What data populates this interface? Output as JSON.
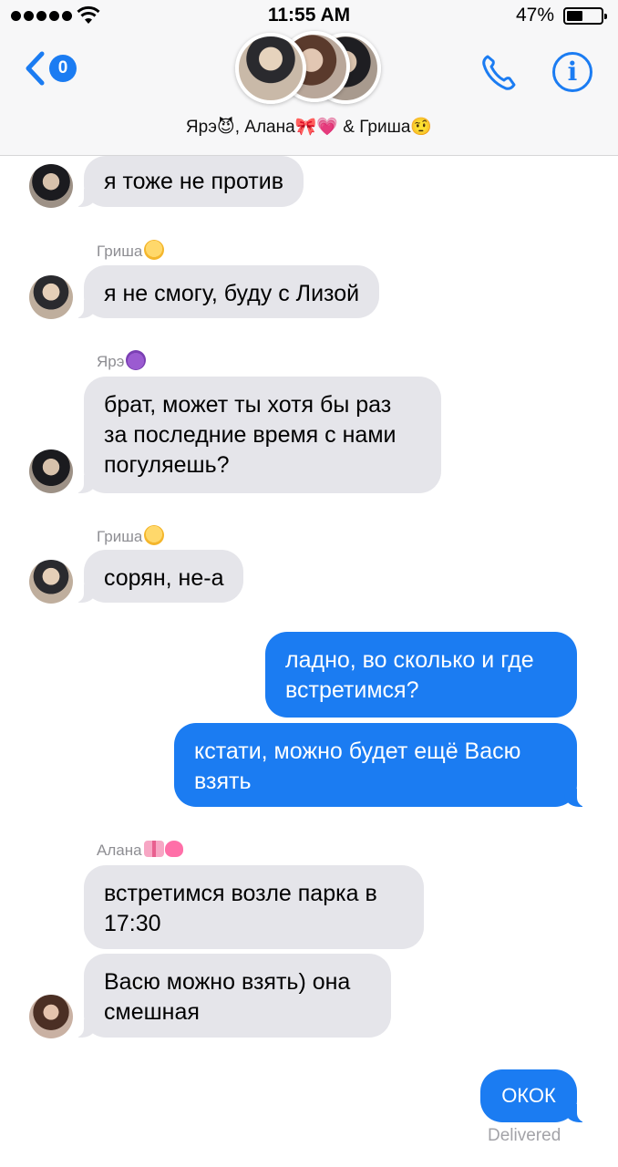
{
  "status_bar": {
    "time": "11:55 AM",
    "battery": "47%"
  },
  "header": {
    "back_badge": "0",
    "conversation_title": "Ярэ😈, Алана🎀💗 & Гриша🤨",
    "icons": {
      "back": "chevron-left-icon",
      "call": "phone-icon",
      "info": "info-icon"
    }
  },
  "senders": {
    "grisha": "Гриша",
    "yare": "Ярэ",
    "alana": "Алана"
  },
  "messages": [
    {
      "from": "yare",
      "text": "я тоже не против"
    },
    {
      "from": "grisha",
      "text": "я не смогу, буду с Лизой"
    },
    {
      "from": "yare",
      "text": "брат, может ты хотя бы раз\nза последние время с нами\nпогуляешь?"
    },
    {
      "from": "grisha",
      "text": "сорян, не-а"
    },
    {
      "from": "me",
      "text": "ладно, во сколько и где\nвстретимся?"
    },
    {
      "from": "me",
      "text": "кстати, можно будет ещё Васю\nвзять"
    },
    {
      "from": "alana",
      "text": "встретимся возле парка в\n17:30"
    },
    {
      "from": "alana",
      "text": "Васю можно взять) она\nсмешная"
    },
    {
      "from": "me",
      "text": "ОКОК"
    }
  ],
  "delivered_label": "Delivered",
  "colors": {
    "accent": "#1b7cf2",
    "incoming_bubble": "#e5e5ea",
    "header_bg": "#f7f7f8"
  }
}
